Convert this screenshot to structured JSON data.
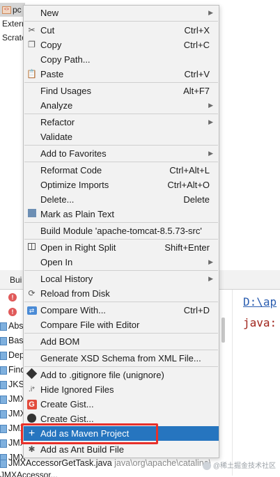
{
  "project_tree": {
    "items": [
      {
        "label": "pc",
        "icon": "xml-file-icon",
        "selected": true
      },
      {
        "label": "Extern"
      },
      {
        "label": "Scrate"
      }
    ]
  },
  "bottom_panel": {
    "tab_label": "Bui",
    "error_rows": [
      "",
      ""
    ],
    "rows": [
      "Abs",
      "Bas",
      "Dep",
      "Find",
      "JKS",
      "JMX",
      "JMX",
      "JMX",
      "JMX",
      "JMX"
    ],
    "last_row_name": "JMXAccessorGetTask.java",
    "last_row_path": "java\\org\\apache\\catalina\\",
    "trunc_row": "JMXAccessor...",
    "console": {
      "link_text": "D:\\ap",
      "error_text": "java:"
    }
  },
  "context_menu": {
    "items": [
      {
        "label": "New",
        "submenu": true
      },
      {
        "label": "Cut",
        "shortcut": "Ctrl+X",
        "icon": "cut-icon",
        "mnemonic": "t"
      },
      {
        "label": "Copy",
        "shortcut": "Ctrl+C",
        "icon": "copy-icon",
        "mnemonic": "C"
      },
      {
        "label": "Copy Path...",
        "shortcut": ""
      },
      {
        "label": "Paste",
        "shortcut": "Ctrl+V",
        "icon": "paste-icon",
        "mnemonic": "P"
      },
      {
        "label": "Find Usages",
        "shortcut": "Alt+F7"
      },
      {
        "label": "Analyze",
        "submenu": true
      },
      {
        "label": "Refactor",
        "submenu": true
      },
      {
        "label": "Validate"
      },
      {
        "label": "Add to Favorites",
        "submenu": true
      },
      {
        "label": "Reformat Code",
        "shortcut": "Ctrl+Alt+L"
      },
      {
        "label": "Optimize Imports",
        "shortcut": "Ctrl+Alt+O"
      },
      {
        "label": "Delete...",
        "shortcut": "Delete"
      },
      {
        "label": "Mark as Plain Text",
        "icon": "plain-text-icon"
      },
      {
        "label": "Build Module 'apache-tomcat-8.5.73-src'"
      },
      {
        "label": "Open in Right Split",
        "shortcut": "Shift+Enter",
        "icon": "split-icon"
      },
      {
        "label": "Open In",
        "submenu": true
      },
      {
        "label": "Local History",
        "submenu": true
      },
      {
        "label": "Reload from Disk",
        "icon": "reload-icon"
      },
      {
        "label": "Compare With...",
        "shortcut": "Ctrl+D",
        "icon": "compare-icon"
      },
      {
        "label": "Compare File with Editor"
      },
      {
        "label": "Add BOM"
      },
      {
        "label": "Generate XSD Schema from XML File..."
      },
      {
        "label": "Add to .gitignore file (unignore)",
        "icon": "git-icon"
      },
      {
        "label": "Hide Ignored Files",
        "icon": "ignore-icon"
      },
      {
        "label": "Create Gist...",
        "icon": "gist-icon"
      },
      {
        "label": "Create Gist...",
        "icon": "github-icon"
      },
      {
        "label": "Add as Maven Project",
        "icon": "plus-icon",
        "highlighted": true
      },
      {
        "label": "Add as Ant Build File",
        "icon": "ant-icon"
      }
    ]
  },
  "annotation": {
    "box_color": "#e8302a"
  },
  "colors": {
    "highlight": "#2675bf",
    "menu_bg": "#f2f2f2"
  },
  "watermark": "@稀土掘金技术社区"
}
